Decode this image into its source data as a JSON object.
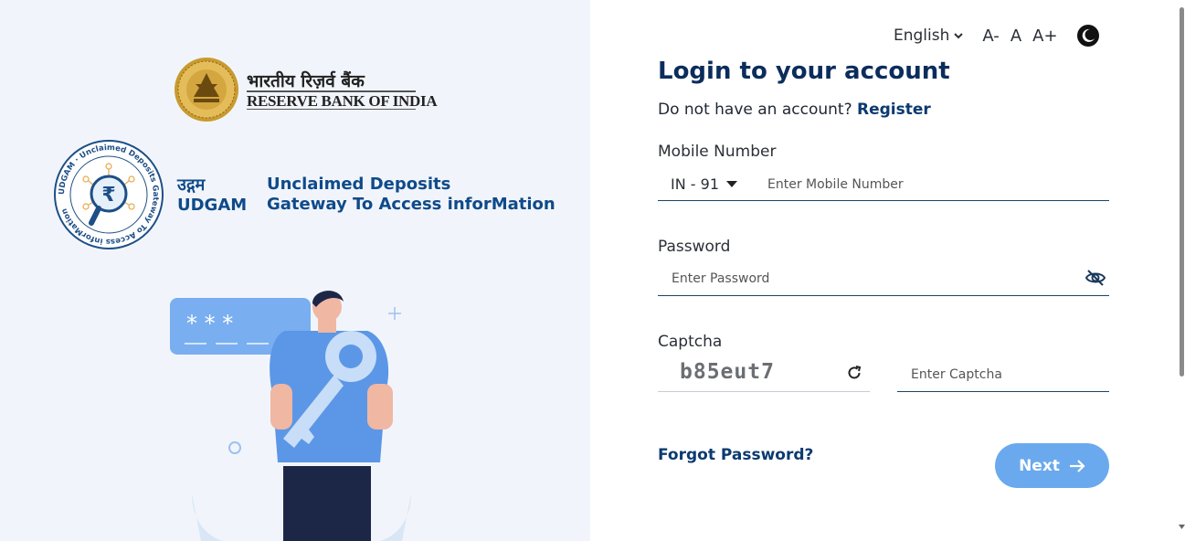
{
  "branding": {
    "rbi_hindi": "भारतीय रिज़र्व बैंक",
    "rbi_english": "RESERVE BANK OF INDIA",
    "udgam_hindi": "उद्गम",
    "udgam_english": "UDGAM",
    "udgam_full_line1": "Unclaimed Deposits",
    "udgam_full_line2": "Gateway To Access inforMation",
    "udgam_ring_text": "UDGAM · Unclaimed Deposits Gateway To Access inforMation",
    "illustration_password_mask": "* * *"
  },
  "topbar": {
    "language": "English",
    "font_decrease": "A-",
    "font_normal": "A",
    "font_increase": "A+",
    "theme_icon": "moon-icon"
  },
  "form": {
    "title": "Login to your account",
    "register_prompt": "Do not have an account?",
    "register_link": "Register",
    "mobile_label": "Mobile Number",
    "country_code": "IN - 91",
    "mobile_placeholder": "Enter Mobile Number",
    "password_label": "Password",
    "password_placeholder": "Enter Password",
    "captcha_label": "Captcha",
    "captcha_value": "b85eut7",
    "captcha_placeholder": "Enter Captcha",
    "forgot_password": "Forgot Password?",
    "next_button": "Next"
  },
  "colors": {
    "primary_dark": "#0b2d5c",
    "link": "#0b3a70",
    "button": "#6aa9ee",
    "left_panel_bg": "#f1f5fb"
  }
}
